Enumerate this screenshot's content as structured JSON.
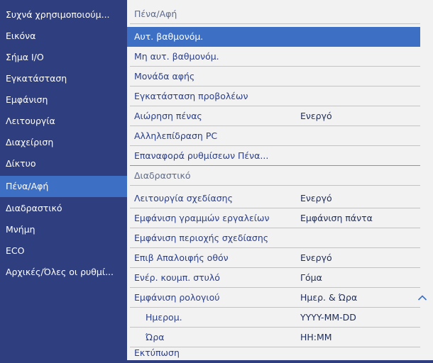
{
  "sidebar": {
    "items": [
      {
        "label": "Συχνά χρησιμοποιούμ..."
      },
      {
        "label": "Εικόνα"
      },
      {
        "label": "Σήμα I/O"
      },
      {
        "label": "Εγκατάσταση"
      },
      {
        "label": "Εμφάνιση"
      },
      {
        "label": "Λειτουργία"
      },
      {
        "label": "Διαχείριση"
      },
      {
        "label": "Δίκτυο"
      },
      {
        "label": "Πένα/Αφή"
      },
      {
        "label": "Διαδραστικό"
      },
      {
        "label": "Μνήμη"
      },
      {
        "label": "ECO"
      },
      {
        "label": "Αρχικές/Όλες οι ρυθμί..."
      }
    ],
    "selected_index": 8
  },
  "panel": {
    "pen_header": "Πένα/Αφή",
    "pen_rows": [
      {
        "label": "Αυτ. βαθμονόμ.",
        "value": ""
      },
      {
        "label": "Μη αυτ. βαθμονόμ.",
        "value": ""
      },
      {
        "label": "Μονάδα αφής",
        "value": ""
      },
      {
        "label": "Εγκατάσταση προβολέων",
        "value": ""
      },
      {
        "label": "Αιώρηση πένας",
        "value": "Ενεργό"
      },
      {
        "label": "Αλληλεπίδραση PC",
        "value": ""
      },
      {
        "label": "Επαναφορά ρυθμίσεων Πένα...",
        "value": ""
      }
    ],
    "interactive_header": "Διαδραστικό",
    "interactive_rows": [
      {
        "label": "Λειτουργία σχεδίασης",
        "value": "Ενεργό"
      },
      {
        "label": "Εμφάνιση γραμμών εργαλείων",
        "value": "Εμφάνιση πάντα"
      },
      {
        "label": "Εμφάνιση περιοχής σχεδίασης",
        "value": ""
      },
      {
        "label": "Επιβ Απαλοιφής οθόν",
        "value": "Ενεργό"
      },
      {
        "label": "Ενέρ. κουμπ. στυλό",
        "value": "Γόμα"
      },
      {
        "label": "Εμφάνιση ρολογιού",
        "value": "Ημερ. & Ώρα"
      },
      {
        "label": "Ημερομ.",
        "value": "YYYY-MM-DD"
      },
      {
        "label": "Ώρα",
        "value": "HH:MM"
      },
      {
        "label": "Εκτύπωση",
        "value": ""
      }
    ],
    "expanded_icon": "chevron-up-icon"
  },
  "colors": {
    "sidebar_bg": "#2e3e7e",
    "selection": "#3d6fc4",
    "panel_bg": "#f2f2f2",
    "text": "#2a3f8c"
  }
}
